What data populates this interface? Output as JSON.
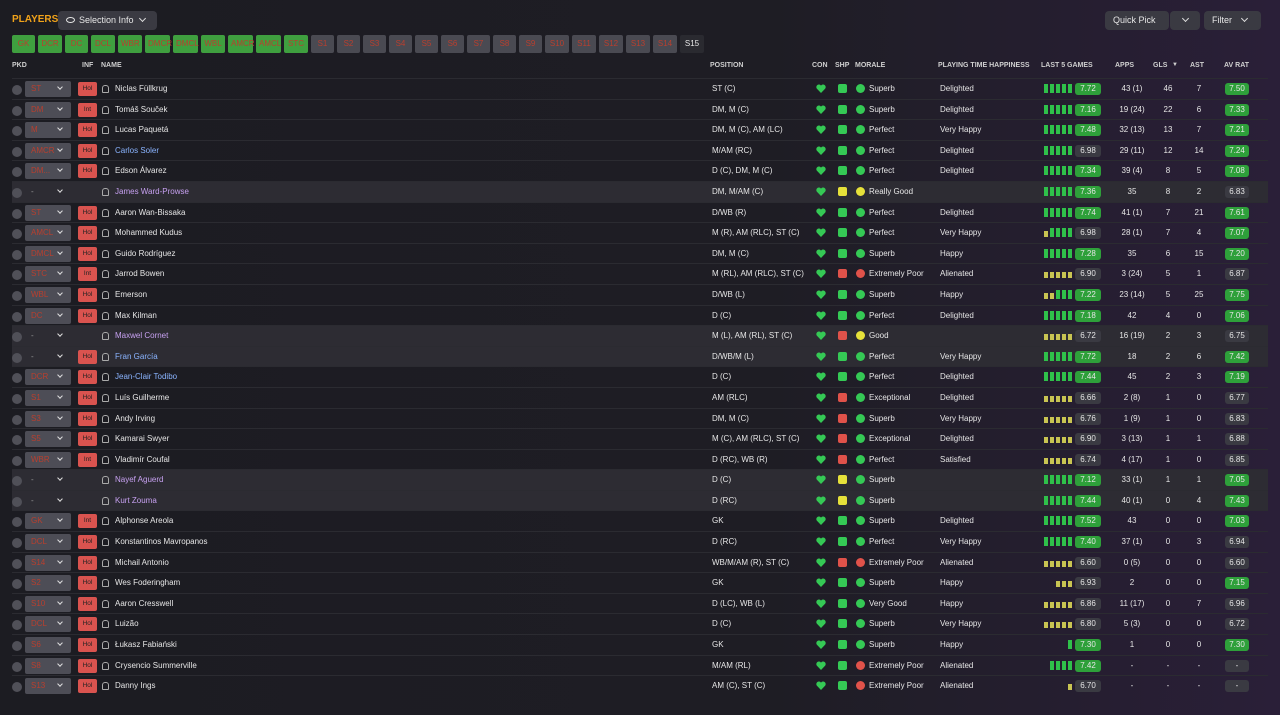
{
  "header": {
    "title": "PLAYERS",
    "selection_info": "Selection Info",
    "quick_pick": "Quick Pick",
    "filter": "Filter"
  },
  "position_tabs": [
    {
      "label": "GK",
      "style": "g"
    },
    {
      "label": "DCR",
      "style": "g"
    },
    {
      "label": "DC",
      "style": "g"
    },
    {
      "label": "DCL",
      "style": "g"
    },
    {
      "label": "WBR",
      "style": "g"
    },
    {
      "label": "DMCR",
      "style": "g"
    },
    {
      "label": "DMCL",
      "style": "g"
    },
    {
      "label": "WBL",
      "style": "g"
    },
    {
      "label": "AMCR",
      "style": "g"
    },
    {
      "label": "AMCL",
      "style": "g"
    },
    {
      "label": "STC",
      "style": "g"
    },
    {
      "label": "S1",
      "style": "s"
    },
    {
      "label": "S2",
      "style": "s"
    },
    {
      "label": "S3",
      "style": "s"
    },
    {
      "label": "S4",
      "style": "s"
    },
    {
      "label": "S5",
      "style": "s"
    },
    {
      "label": "S6",
      "style": "s"
    },
    {
      "label": "S7",
      "style": "s"
    },
    {
      "label": "S8",
      "style": "s"
    },
    {
      "label": "S9",
      "style": "s"
    },
    {
      "label": "S10",
      "style": "s"
    },
    {
      "label": "S11",
      "style": "s"
    },
    {
      "label": "S12",
      "style": "s"
    },
    {
      "label": "S13",
      "style": "s"
    },
    {
      "label": "S14",
      "style": "s"
    },
    {
      "label": "S15",
      "style": "act"
    }
  ],
  "columns": {
    "pkd": "PKD",
    "inf": "INF",
    "name": "NAME",
    "position": "POSITION",
    "con": "CON",
    "shp": "SHP",
    "morale": "MORALE",
    "pth": "PLAYING TIME HAPPINESS",
    "last5": "LAST 5 GAMES",
    "apps": "APPS",
    "gls": "GLS",
    "ast": "AST",
    "avrat": "AV RAT"
  },
  "rows": [
    {
      "pkd": "ST",
      "inf": "Hol",
      "name": "Niclas Füllkrug",
      "nc": "",
      "pos": "ST (C)",
      "shp": "g",
      "mor": "g",
      "morale": "Superb",
      "pth": "Delighted",
      "l5": [
        1,
        1,
        1,
        1,
        1
      ],
      "rat": "7.72",
      "rd": false,
      "apps": "43 (1)",
      "gls": "46",
      "ast": "7",
      "av": "7.50",
      "ad": false,
      "u": false
    },
    {
      "pkd": "DM",
      "inf": "Int",
      "name": "Tomáš Souček",
      "nc": "",
      "pos": "DM, M (C)",
      "shp": "g",
      "mor": "g",
      "morale": "Superb",
      "pth": "Delighted",
      "l5": [
        1,
        1,
        1,
        1,
        1
      ],
      "rat": "7.16",
      "rd": false,
      "apps": "19 (24)",
      "gls": "22",
      "ast": "6",
      "av": "7.33",
      "ad": false,
      "u": false
    },
    {
      "pkd": "M",
      "inf": "Hol",
      "name": "Lucas Paquetá",
      "nc": "",
      "pos": "DM, M (C), AM (LC)",
      "shp": "g",
      "mor": "g",
      "morale": "Perfect",
      "pth": "Very Happy",
      "l5": [
        1,
        1,
        1,
        1,
        1
      ],
      "rat": "7.48",
      "rd": false,
      "apps": "32 (13)",
      "gls": "13",
      "ast": "7",
      "av": "7.21",
      "ad": false,
      "u": false
    },
    {
      "pkd": "AMCR",
      "inf": "Hol",
      "name": "Carlos Soler",
      "nc": "blue",
      "pos": "M/AM (RC)",
      "shp": "g",
      "mor": "g",
      "morale": "Perfect",
      "pth": "Delighted",
      "l5": [
        1,
        1,
        1,
        1,
        1
      ],
      "rat": "6.98",
      "rd": true,
      "apps": "29 (11)",
      "gls": "12",
      "ast": "14",
      "av": "7.24",
      "ad": false,
      "u": false
    },
    {
      "pkd": "DM...",
      "inf": "Hol",
      "name": "Edson Álvarez",
      "nc": "",
      "pos": "D (C), DM, M (C)",
      "shp": "g",
      "mor": "g",
      "morale": "Perfect",
      "pth": "Delighted",
      "l5": [
        1,
        1,
        1,
        1,
        1
      ],
      "rat": "7.34",
      "rd": false,
      "apps": "39 (4)",
      "gls": "8",
      "ast": "5",
      "av": "7.08",
      "ad": false,
      "u": false
    },
    {
      "pkd": "-",
      "inf": "",
      "name": "James Ward-Prowse",
      "nc": "loan",
      "pos": "DM, M/AM (C)",
      "shp": "y",
      "mor": "y",
      "morale": "Really Good",
      "pth": "",
      "l5": [
        1,
        1,
        1,
        1,
        1
      ],
      "rat": "7.36",
      "rd": false,
      "apps": "35",
      "gls": "8",
      "ast": "2",
      "av": "6.83",
      "ad": true,
      "u": true
    },
    {
      "pkd": "ST",
      "inf": "Hol",
      "name": "Aaron Wan-Bissaka",
      "nc": "",
      "pos": "D/WB (R)",
      "shp": "g",
      "mor": "g",
      "morale": "Perfect",
      "pth": "Delighted",
      "l5": [
        1,
        1,
        1,
        1,
        1
      ],
      "rat": "7.74",
      "rd": false,
      "apps": "41 (1)",
      "gls": "7",
      "ast": "21",
      "av": "7.61",
      "ad": false,
      "u": false
    },
    {
      "pkd": "AMCL",
      "inf": "Hol",
      "name": "Mohammed Kudus",
      "nc": "",
      "pos": "M (R), AM (RLC), ST (C)",
      "shp": "g",
      "mor": "g",
      "morale": "Perfect",
      "pth": "Very Happy",
      "l5": [
        0,
        1,
        1,
        1,
        1
      ],
      "rat": "6.98",
      "rd": true,
      "apps": "28 (1)",
      "gls": "7",
      "ast": "4",
      "av": "7.07",
      "ad": false,
      "u": false
    },
    {
      "pkd": "DMCL",
      "inf": "Hol",
      "name": "Guido Rodríguez",
      "nc": "",
      "pos": "DM, M (C)",
      "shp": "g",
      "mor": "g",
      "morale": "Superb",
      "pth": "Happy",
      "l5": [
        1,
        1,
        1,
        1,
        1
      ],
      "rat": "7.28",
      "rd": false,
      "apps": "35",
      "gls": "6",
      "ast": "15",
      "av": "7.20",
      "ad": false,
      "u": false
    },
    {
      "pkd": "STC",
      "inf": "Int",
      "name": "Jarrod Bowen",
      "nc": "",
      "pos": "M (RL), AM (RLC), ST (C)",
      "shp": "r",
      "mor": "r",
      "morale": "Extremely Poor",
      "pth": "Alienated",
      "l5": [
        0,
        0,
        0,
        0,
        0
      ],
      "rat": "6.90",
      "rd": true,
      "apps": "3 (24)",
      "gls": "5",
      "ast": "1",
      "av": "6.87",
      "ad": true,
      "u": false
    },
    {
      "pkd": "WBL",
      "inf": "Hol",
      "name": "Emerson",
      "nc": "",
      "pos": "D/WB (L)",
      "shp": "g",
      "mor": "g",
      "morale": "Superb",
      "pth": "Happy",
      "l5": [
        0,
        0,
        1,
        1,
        1
      ],
      "rat": "7.22",
      "rd": false,
      "apps": "23 (14)",
      "gls": "5",
      "ast": "25",
      "av": "7.75",
      "ad": false,
      "u": false
    },
    {
      "pkd": "DC",
      "inf": "Hol",
      "name": "Max Kilman",
      "nc": "",
      "pos": "D (C)",
      "shp": "g",
      "mor": "g",
      "morale": "Perfect",
      "pth": "Delighted",
      "l5": [
        1,
        1,
        1,
        1,
        1
      ],
      "rat": "7.18",
      "rd": false,
      "apps": "42",
      "gls": "4",
      "ast": "0",
      "av": "7.06",
      "ad": false,
      "u": false
    },
    {
      "pkd": "-",
      "inf": "",
      "name": "Maxwel Cornet",
      "nc": "loan",
      "pos": "M (L), AM (RL), ST (C)",
      "shp": "r",
      "mor": "y",
      "morale": "Good",
      "pth": "",
      "l5": [
        0,
        0,
        0,
        0,
        0
      ],
      "rat": "6.72",
      "rd": true,
      "apps": "16 (19)",
      "gls": "2",
      "ast": "3",
      "av": "6.75",
      "ad": true,
      "u": true
    },
    {
      "pkd": "-",
      "inf": "Hol",
      "name": "Fran García",
      "nc": "blue",
      "pos": "D/WB/M (L)",
      "shp": "g",
      "mor": "g",
      "morale": "Perfect",
      "pth": "Very Happy",
      "l5": [
        1,
        1,
        1,
        1,
        1
      ],
      "rat": "7.72",
      "rd": false,
      "apps": "18",
      "gls": "2",
      "ast": "6",
      "av": "7.42",
      "ad": false,
      "u": true
    },
    {
      "pkd": "DCR",
      "inf": "Hol",
      "name": "Jean-Clair Todibo",
      "nc": "blue",
      "pos": "D (C)",
      "shp": "g",
      "mor": "g",
      "morale": "Perfect",
      "pth": "Delighted",
      "l5": [
        1,
        1,
        1,
        1,
        1
      ],
      "rat": "7.44",
      "rd": false,
      "apps": "45",
      "gls": "2",
      "ast": "3",
      "av": "7.19",
      "ad": false,
      "u": false
    },
    {
      "pkd": "S1",
      "inf": "Hol",
      "name": "Luís Guilherme",
      "nc": "",
      "pos": "AM (RLC)",
      "shp": "r",
      "mor": "g",
      "morale": "Exceptional",
      "pth": "Delighted",
      "l5": [
        0,
        0,
        0,
        0,
        0
      ],
      "rat": "6.66",
      "rd": true,
      "apps": "2 (8)",
      "gls": "1",
      "ast": "0",
      "av": "6.77",
      "ad": true,
      "u": false
    },
    {
      "pkd": "S3",
      "inf": "Hol",
      "name": "Andy Irving",
      "nc": "",
      "pos": "DM, M (C)",
      "shp": "r",
      "mor": "g",
      "morale": "Superb",
      "pth": "Very Happy",
      "l5": [
        0,
        0,
        0,
        0,
        0
      ],
      "rat": "6.76",
      "rd": true,
      "apps": "1 (9)",
      "gls": "1",
      "ast": "0",
      "av": "6.83",
      "ad": true,
      "u": false
    },
    {
      "pkd": "S5",
      "inf": "Hol",
      "name": "Kamarai Swyer",
      "nc": "",
      "pos": "M (C), AM (RLC), ST (C)",
      "shp": "r",
      "mor": "g",
      "morale": "Exceptional",
      "pth": "Delighted",
      "l5": [
        0,
        0,
        0,
        0,
        0
      ],
      "rat": "6.90",
      "rd": true,
      "apps": "3 (13)",
      "gls": "1",
      "ast": "1",
      "av": "6.88",
      "ad": true,
      "u": false
    },
    {
      "pkd": "WBR",
      "inf": "Int",
      "name": "Vladimír Coufal",
      "nc": "",
      "pos": "D (RC), WB (R)",
      "shp": "r",
      "mor": "g",
      "morale": "Perfect",
      "pth": "Satisfied",
      "l5": [
        0,
        0,
        0,
        0,
        0
      ],
      "rat": "6.74",
      "rd": true,
      "apps": "4 (17)",
      "gls": "1",
      "ast": "0",
      "av": "6.85",
      "ad": true,
      "u": false
    },
    {
      "pkd": "-",
      "inf": "",
      "name": "Nayef Aguerd",
      "nc": "loan",
      "pos": "D (C)",
      "shp": "y",
      "mor": "g",
      "morale": "Superb",
      "pth": "",
      "l5": [
        1,
        1,
        1,
        1,
        1
      ],
      "rat": "7.12",
      "rd": false,
      "apps": "33 (1)",
      "gls": "1",
      "ast": "1",
      "av": "7.05",
      "ad": false,
      "u": true
    },
    {
      "pkd": "-",
      "inf": "",
      "name": "Kurt Zouma",
      "nc": "loan",
      "pos": "D (RC)",
      "shp": "y",
      "mor": "g",
      "morale": "Superb",
      "pth": "",
      "l5": [
        1,
        1,
        1,
        1,
        1
      ],
      "rat": "7.44",
      "rd": false,
      "apps": "40 (1)",
      "gls": "0",
      "ast": "4",
      "av": "7.43",
      "ad": false,
      "u": true
    },
    {
      "pkd": "GK",
      "inf": "Int",
      "name": "Alphonse Areola",
      "nc": "",
      "pos": "GK",
      "shp": "g",
      "mor": "g",
      "morale": "Superb",
      "pth": "Delighted",
      "l5": [
        1,
        1,
        1,
        1,
        1
      ],
      "rat": "7.52",
      "rd": false,
      "apps": "43",
      "gls": "0",
      "ast": "0",
      "av": "7.03",
      "ad": false,
      "u": false
    },
    {
      "pkd": "DCL",
      "inf": "Hol",
      "name": "Konstantinos Mavropanos",
      "nc": "",
      "pos": "D (RC)",
      "shp": "g",
      "mor": "g",
      "morale": "Perfect",
      "pth": "Very Happy",
      "l5": [
        1,
        1,
        1,
        1,
        1
      ],
      "rat": "7.40",
      "rd": false,
      "apps": "37 (1)",
      "gls": "0",
      "ast": "3",
      "av": "6.94",
      "ad": true,
      "u": false
    },
    {
      "pkd": "S14",
      "inf": "Hol",
      "name": "Michail Antonio",
      "nc": "",
      "pos": "WB/M/AM (R), ST (C)",
      "shp": "r",
      "mor": "r",
      "morale": "Extremely Poor",
      "pth": "Alienated",
      "l5": [
        0,
        0,
        0,
        0,
        0
      ],
      "rat": "6.60",
      "rd": true,
      "apps": "0 (5)",
      "gls": "0",
      "ast": "0",
      "av": "6.60",
      "ad": true,
      "u": false
    },
    {
      "pkd": "S2",
      "inf": "Hol",
      "name": "Wes Foderingham",
      "nc": "",
      "pos": "GK",
      "shp": "g",
      "mor": "g",
      "morale": "Superb",
      "pth": "Happy",
      "l5": [
        0,
        0,
        0
      ],
      "rat": "6.93",
      "rd": true,
      "apps": "2",
      "gls": "0",
      "ast": "0",
      "av": "7.15",
      "ad": false,
      "u": false
    },
    {
      "pkd": "S10",
      "inf": "Hol",
      "name": "Aaron Cresswell",
      "nc": "",
      "pos": "D (LC), WB (L)",
      "shp": "g",
      "mor": "g",
      "morale": "Very Good",
      "pth": "Happy",
      "l5": [
        0,
        0,
        0,
        0,
        0
      ],
      "rat": "6.86",
      "rd": true,
      "apps": "11 (17)",
      "gls": "0",
      "ast": "7",
      "av": "6.96",
      "ad": true,
      "u": false
    },
    {
      "pkd": "DCL",
      "inf": "Hol",
      "name": "Luizão",
      "nc": "",
      "pos": "D (C)",
      "shp": "g",
      "mor": "g",
      "morale": "Superb",
      "pth": "Very Happy",
      "l5": [
        0,
        0,
        0,
        0,
        0
      ],
      "rat": "6.80",
      "rd": true,
      "apps": "5 (3)",
      "gls": "0",
      "ast": "0",
      "av": "6.72",
      "ad": true,
      "u": false
    },
    {
      "pkd": "S6",
      "inf": "Hol",
      "name": "Łukasz Fabiański",
      "nc": "",
      "pos": "GK",
      "shp": "g",
      "mor": "g",
      "morale": "Superb",
      "pth": "Happy",
      "l5": [
        1
      ],
      "rat": "7.30",
      "rd": false,
      "apps": "1",
      "gls": "0",
      "ast": "0",
      "av": "7.30",
      "ad": false,
      "u": false
    },
    {
      "pkd": "S8",
      "inf": "Hol",
      "name": "Crysencio Summerville",
      "nc": "",
      "pos": "M/AM (RL)",
      "shp": "g",
      "mor": "r",
      "morale": "Extremely Poor",
      "pth": "Alienated",
      "l5": [
        1,
        1,
        1,
        1
      ],
      "rat": "7.42",
      "rd": false,
      "apps": "-",
      "gls": "-",
      "ast": "-",
      "av": "-",
      "ad": true,
      "u": false
    },
    {
      "pkd": "S13",
      "inf": "Hol",
      "name": "Danny Ings",
      "nc": "",
      "pos": "AM (C), ST (C)",
      "shp": "g",
      "mor": "r",
      "morale": "Extremely Poor",
      "pth": "Alienated",
      "l5": [
        0
      ],
      "rat": "6.70",
      "rd": true,
      "apps": "-",
      "gls": "-",
      "ast": "-",
      "av": "-",
      "ad": true,
      "u": false
    }
  ],
  "colors": {
    "accent_title": "#f0a21a",
    "position_tab_green": "#3f9f3f",
    "rating_green": "#2ea03a",
    "condition_green": "#35c955",
    "warning_red": "#e0524a",
    "loan_name_purple": "#c6a0f0",
    "new_signing_blue": "#8ab4ff"
  },
  "icons": {
    "selection_info": "eye-icon",
    "dropdown": "chevron-down-icon",
    "condition": "heart-icon",
    "sharpness": "square-status-icon",
    "morale": "circle-status-icon",
    "player": "person-icon"
  }
}
